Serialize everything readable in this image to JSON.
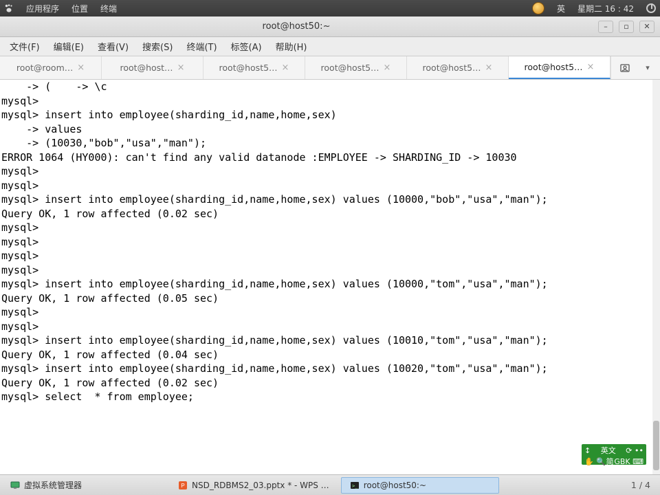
{
  "topbar": {
    "apps": "应用程序",
    "places": "位置",
    "terminal": "终端",
    "lang": "英",
    "date": "星期二 16 : 42"
  },
  "window": {
    "title": "root@host50:~"
  },
  "menubar": {
    "file": "文件(F)",
    "edit": "编辑(E)",
    "view": "查看(V)",
    "search": "搜索(S)",
    "terminal": "终端(T)",
    "tabs": "标签(A)",
    "help": "帮助(H)"
  },
  "tabs": [
    {
      "label": "root@room…"
    },
    {
      "label": "root@host…"
    },
    {
      "label": "root@host5…"
    },
    {
      "label": "root@host5…"
    },
    {
      "label": "root@host5…"
    },
    {
      "label": "root@host5…",
      "active": true
    }
  ],
  "terminal_lines": [
    "    -> (    -> \\c",
    "mysql>",
    "mysql> insert into employee(sharding_id,name,home,sex)",
    "    -> values",
    "    -> (10030,\"bob\",\"usa\",\"man\");",
    "ERROR 1064 (HY000): can't find any valid datanode :EMPLOYEE -> SHARDING_ID -> 10030",
    "mysql>",
    "mysql>",
    "mysql> insert into employee(sharding_id,name,home,sex) values (10000,\"bob\",\"usa\",\"man\");",
    "Query OK, 1 row affected (0.02 sec)",
    "",
    "mysql>",
    "mysql>",
    "mysql>",
    "mysql>",
    "mysql> insert into employee(sharding_id,name,home,sex) values (10000,\"tom\",\"usa\",\"man\");",
    "Query OK, 1 row affected (0.05 sec)",
    "",
    "mysql>",
    "mysql>",
    "mysql> insert into employee(sharding_id,name,home,sex) values (10010,\"tom\",\"usa\",\"man\");",
    "Query OK, 1 row affected (0.04 sec)",
    "",
    "mysql> insert into employee(sharding_id,name,home,sex) values (10020,\"tom\",\"usa\",\"man\");",
    "Query OK, 1 row affected (0.02 sec)",
    "",
    "mysql> select  * from employee;"
  ],
  "ime": {
    "row1_left": "↕",
    "row1_mid": "英文",
    "row1_right": "⟳ ••",
    "row2_left": "✋ 🔍",
    "row2_mid": "简",
    "row2_right": "GBK ⌨"
  },
  "taskbar": {
    "vm": "虚拟系统管理器",
    "wps": "NSD_RDBMS2_03.pptx * - WPS …",
    "term": "root@host50:~",
    "workspace": "1 / 4"
  }
}
